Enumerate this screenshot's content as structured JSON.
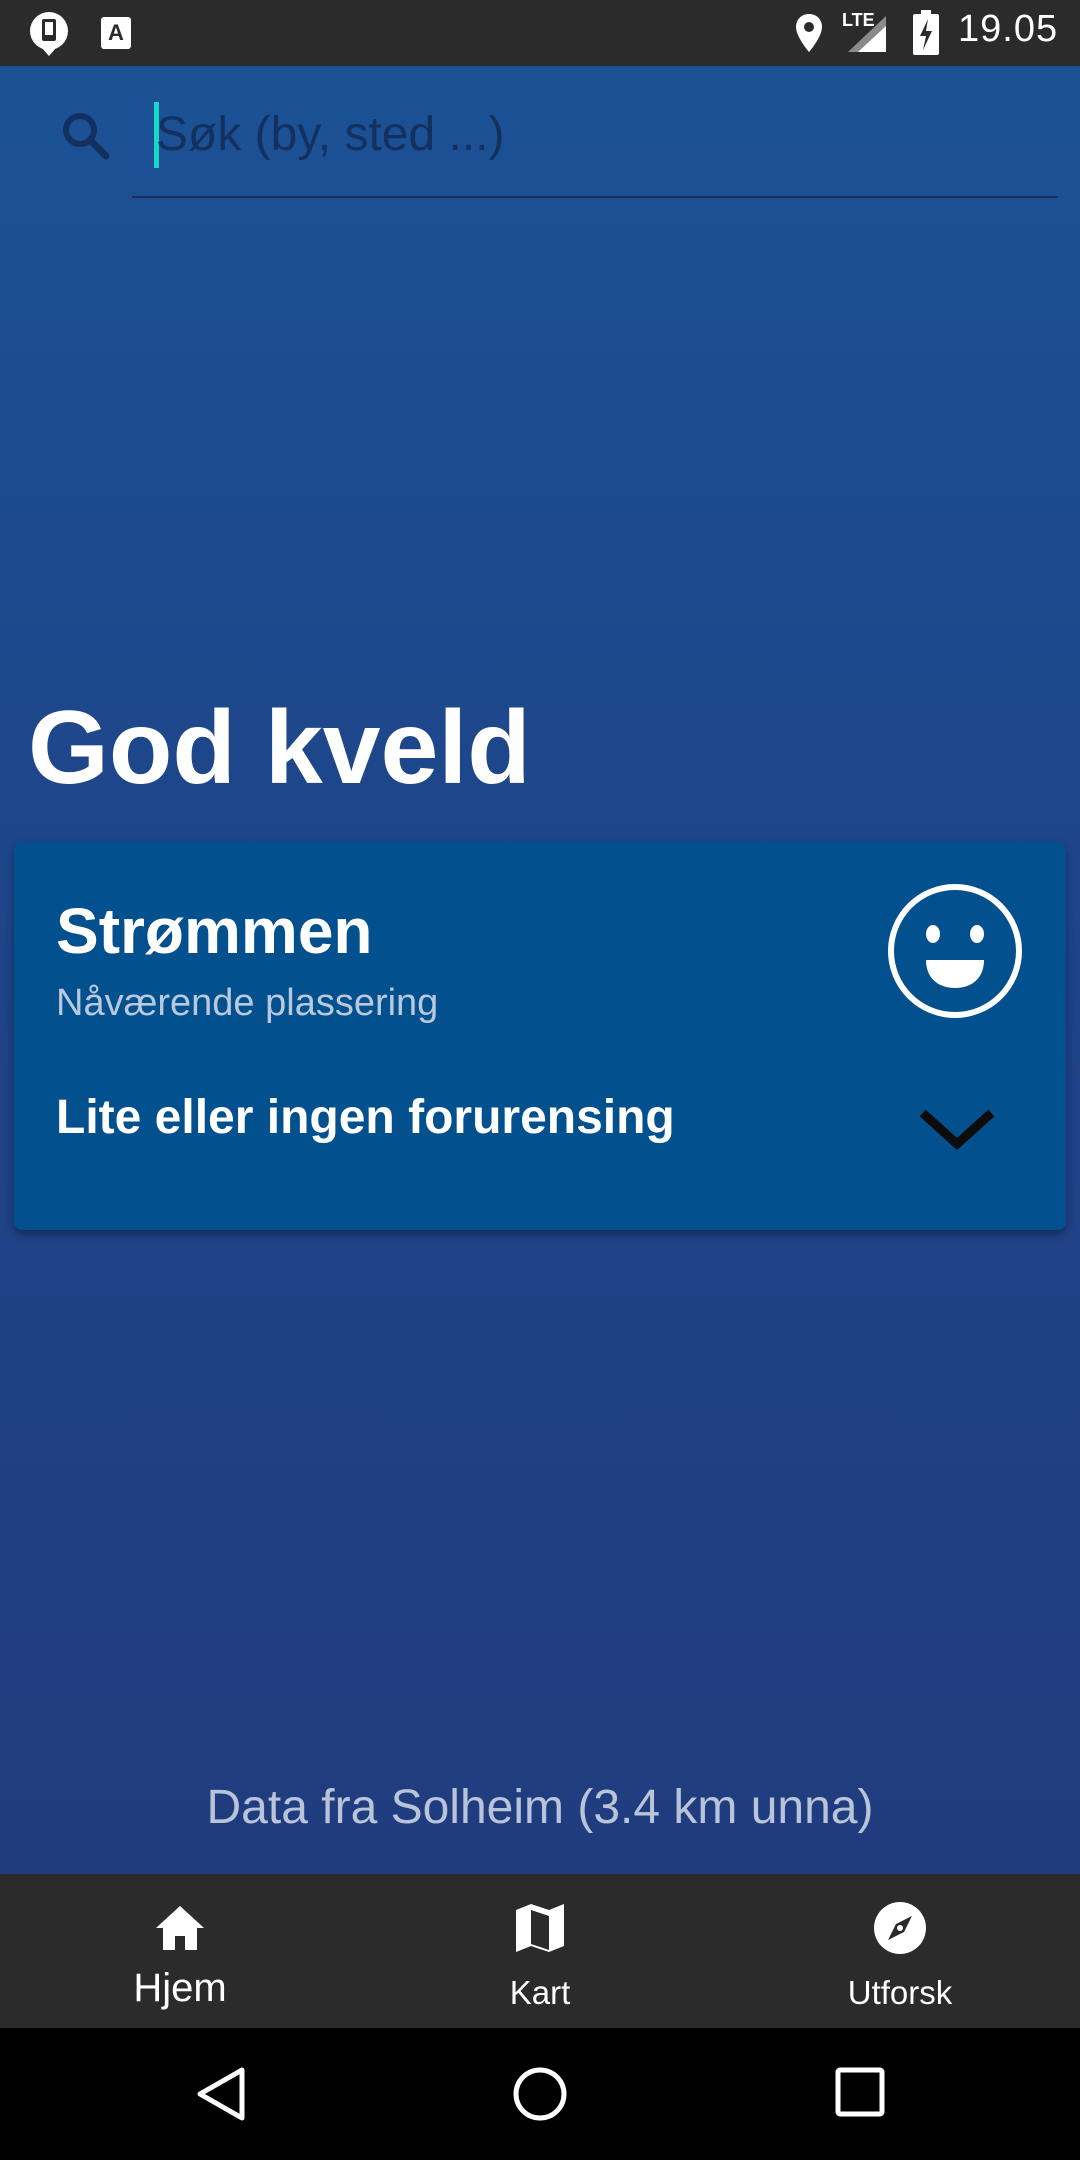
{
  "status_bar": {
    "time": "19.05",
    "network": "LTE",
    "icons": [
      "notification-icon",
      "keyboard-a-icon",
      "location-icon",
      "signal-icon",
      "battery-charging-icon"
    ]
  },
  "search": {
    "placeholder": "Søk (by, sted ...)"
  },
  "greeting": "God kveld",
  "location_card": {
    "title": "Strømmen",
    "subtitle": "Nåværende plassering",
    "status": "Lite eller ingen forurensing",
    "icon": "smiley-icon",
    "expand_icon": "chevron-down-icon"
  },
  "data_source": "Data fra Solheim (3.4 km unna)",
  "bottom_nav": {
    "items": [
      {
        "label": "Hjem",
        "icon": "home-icon",
        "active": true
      },
      {
        "label": "Kart",
        "icon": "map-icon",
        "active": false
      },
      {
        "label": "Utforsk",
        "icon": "compass-icon",
        "active": false
      }
    ]
  },
  "colors": {
    "background_top": "#1a5396",
    "background_bottom": "#213a7c",
    "card": "#03508f",
    "cursor": "#1ad6c8",
    "nav_bar": "#2b2b2b"
  }
}
